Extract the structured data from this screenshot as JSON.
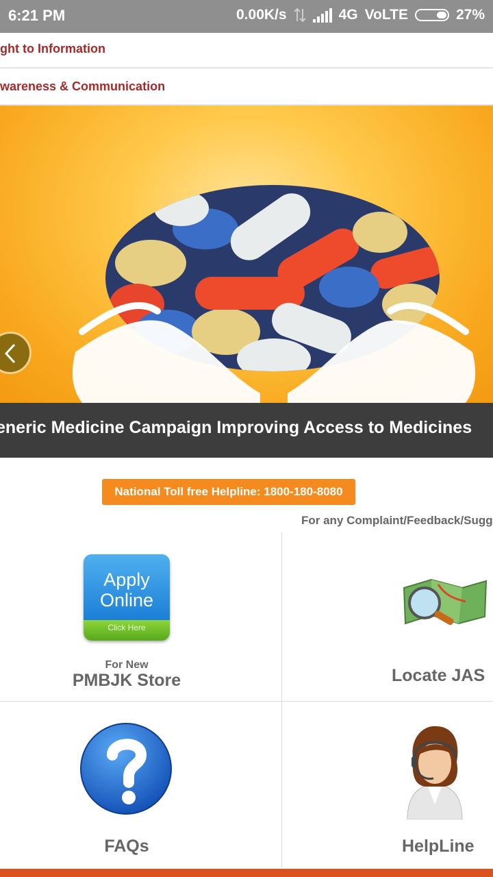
{
  "status_bar": {
    "time": "6:21 PM",
    "speed": "0.00K/s",
    "network": "4G",
    "volte": "VoLTE",
    "battery": "27%"
  },
  "menu": {
    "items": [
      {
        "label": "ght to Information"
      },
      {
        "label": "wareness & Communication"
      }
    ]
  },
  "banner": {
    "caption": "eneric Medicine Campaign Improving Access to Medicines"
  },
  "helpline_button": {
    "label": "National Toll free Helpline: 1800-180-8080"
  },
  "complaint_text": "For any Complaint/Feedback/Sugge",
  "tiles": {
    "apply": {
      "icon_line1": "Apply",
      "icon_line2": "Online",
      "icon_line3": "Click Here",
      "sub": "For New",
      "title": "PMBJK Store"
    },
    "locate": {
      "title": "Locate JAS"
    },
    "faqs": {
      "title": "FAQs"
    },
    "helpline": {
      "title": "HelpLine"
    }
  },
  "colors": {
    "menu_text": "#a52a2a",
    "button": "#f58a1f",
    "caption_bg": "#3d3d3d",
    "bottom_bar": "#d9531e"
  }
}
